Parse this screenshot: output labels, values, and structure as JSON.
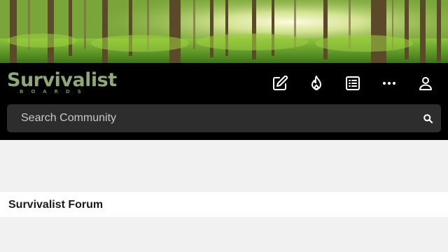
{
  "banner": {
    "image": "forest-sunlight-banner"
  },
  "logo": {
    "main": "Survivalist",
    "sub": "BOARDS"
  },
  "nav": {
    "icons": [
      "edit-icon",
      "flame-icon",
      "list-icon",
      "more-icon",
      "user-icon"
    ]
  },
  "search": {
    "placeholder": "Search Community"
  },
  "forum": {
    "title": "Survivalist Forum"
  },
  "colors": {
    "topbar": "#000000",
    "search_bg": "#2d2d2d",
    "logo_green": "#8fa878",
    "page_bg": "#f1f1f1"
  }
}
